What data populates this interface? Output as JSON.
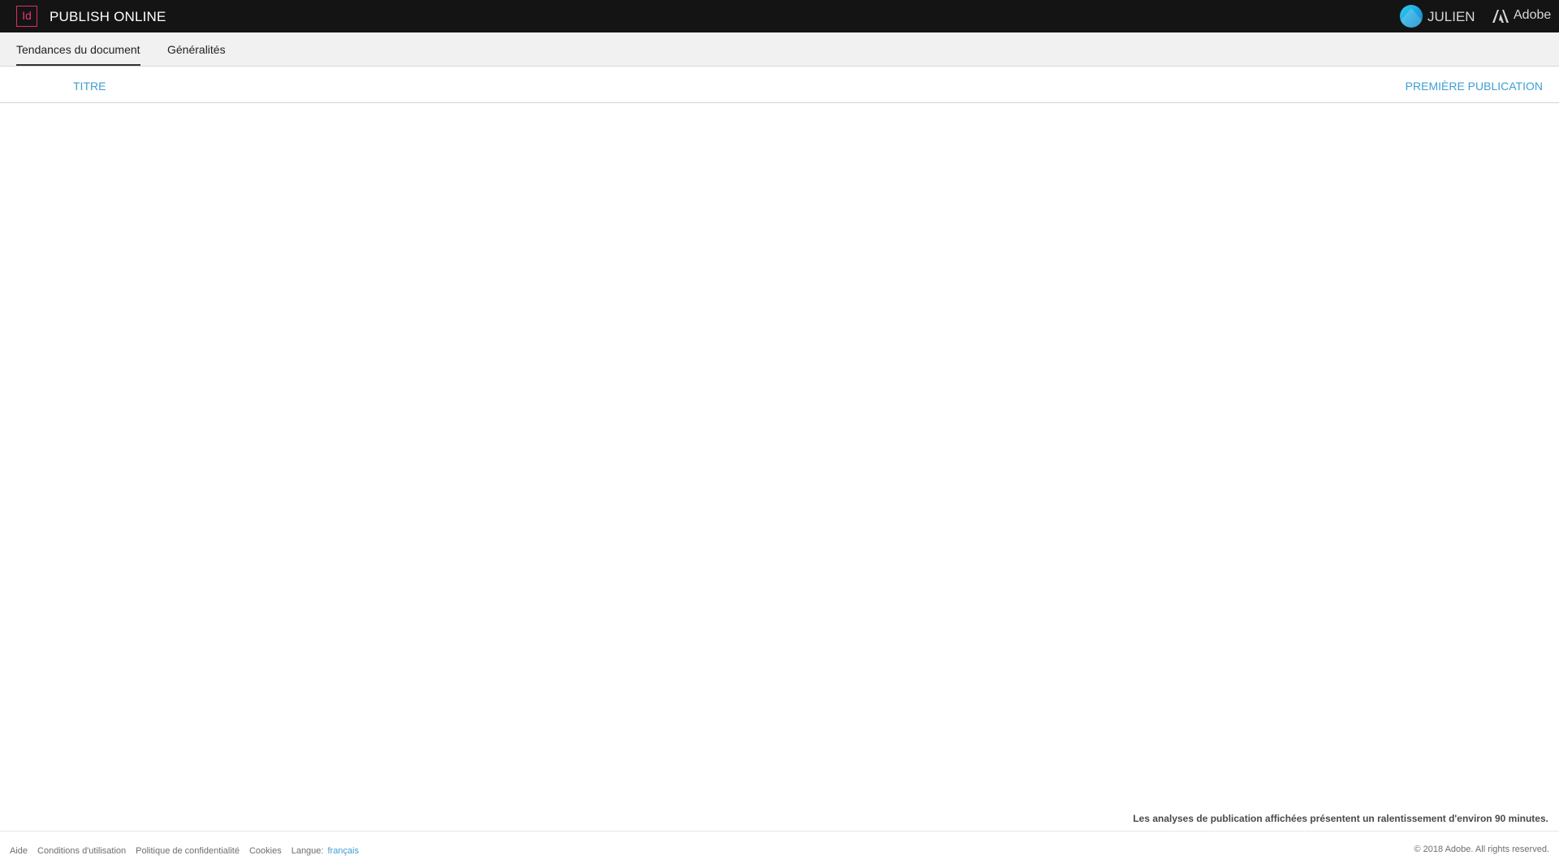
{
  "header": {
    "app_logo_text": "Id",
    "app_title": "PUBLISH ONLINE",
    "user_name": "JULIEN",
    "adobe_label": "Adobe",
    "icons": {
      "app_logo": "indesign-logo-icon",
      "avatar": "user-avatar",
      "adobe": "adobe-logo-icon"
    },
    "colors": {
      "bar_bg": "#141414",
      "logo_accent": "#e8357b",
      "avatar": "#1ba3df"
    }
  },
  "tabs": [
    {
      "label": "Tendances du document",
      "active": true
    },
    {
      "label": "Généralités",
      "active": false
    }
  ],
  "table": {
    "columns": [
      "TITRE",
      "PREMIÈRE PUBLICATION"
    ],
    "rows": [],
    "header_color": "#3f9ed2"
  },
  "notice": "Les analyses de publication affichées présentent un ralentissement d'environ 90 minutes.",
  "footer": {
    "links": [
      "Aide",
      "Conditions d'utilisation",
      "Politique de confidentialité",
      "Cookies"
    ],
    "language_label": "Langue:",
    "language_value": "français",
    "copyright": "© 2018 Adobe. All rights reserved."
  }
}
